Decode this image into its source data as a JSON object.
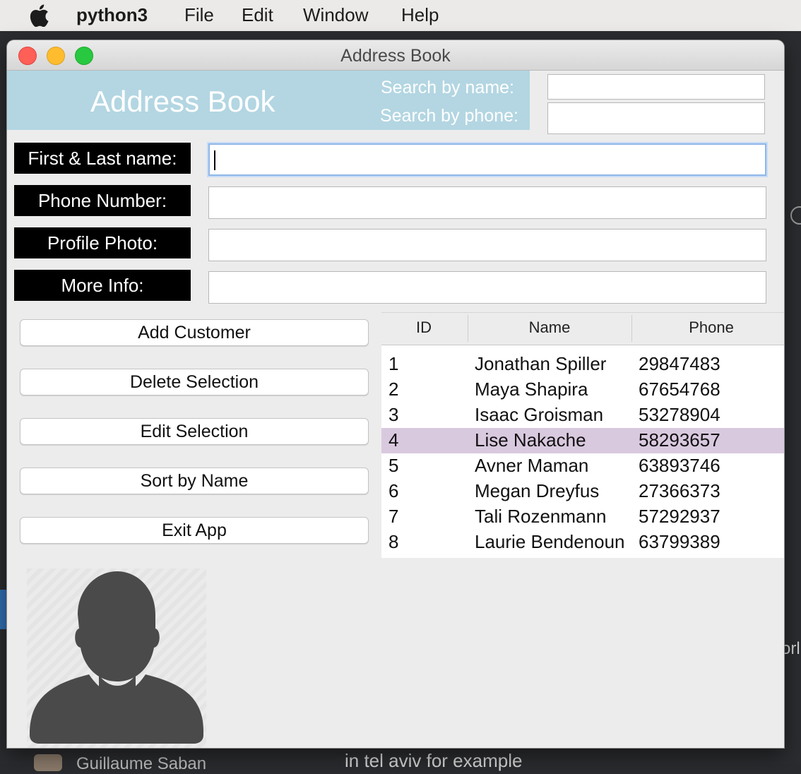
{
  "menubar": {
    "app_name": "python3",
    "items": [
      "File",
      "Edit",
      "Window",
      "Help"
    ]
  },
  "window": {
    "title": "Address Book"
  },
  "header": {
    "title": "Address Book",
    "search_name_label": "Search by name:",
    "search_phone_label": "Search by phone:",
    "search_name_value": "",
    "search_phone_value": ""
  },
  "form": {
    "fields": [
      {
        "label": "First & Last name:",
        "value": ""
      },
      {
        "label": "Phone Number:",
        "value": ""
      },
      {
        "label": "Profile Photo:",
        "value": ""
      },
      {
        "label": "More Info:",
        "value": ""
      }
    ]
  },
  "buttons": {
    "add": "Add Customer",
    "delete": "Delete Selection",
    "edit": "Edit Selection",
    "sort": "Sort by Name",
    "exit": "Exit App"
  },
  "table": {
    "columns": [
      "ID",
      "Name",
      "Phone"
    ],
    "selected_id": "4",
    "rows": [
      {
        "id": "1",
        "name": "Jonathan Spiller",
        "phone": "29847483"
      },
      {
        "id": "2",
        "name": "Maya Shapira",
        "phone": "67654768"
      },
      {
        "id": "3",
        "name": "Isaac Groisman",
        "phone": "53278904"
      },
      {
        "id": "4",
        "name": "Lise Nakache",
        "phone": "58293657"
      },
      {
        "id": "5",
        "name": "Avner Maman",
        "phone": "63893746"
      },
      {
        "id": "6",
        "name": "Megan Dreyfus",
        "phone": "27366373"
      },
      {
        "id": "7",
        "name": "Tali Rozenmann",
        "phone": "57292937"
      },
      {
        "id": "8",
        "name": "Laurie Bendenoun",
        "phone": "63799389"
      }
    ]
  },
  "background": {
    "right_fragment": "orl",
    "bottom_text": "in tel aviv for example",
    "bottom_name": "Guillaume Saban"
  },
  "colors": {
    "header_bg": "#b3d6e2",
    "label_bg": "#000000",
    "selected_row": "#d9c9df"
  },
  "icons": {
    "apple": "apple-logo-icon",
    "profile_photo": "default-user-silhouette-icon"
  }
}
